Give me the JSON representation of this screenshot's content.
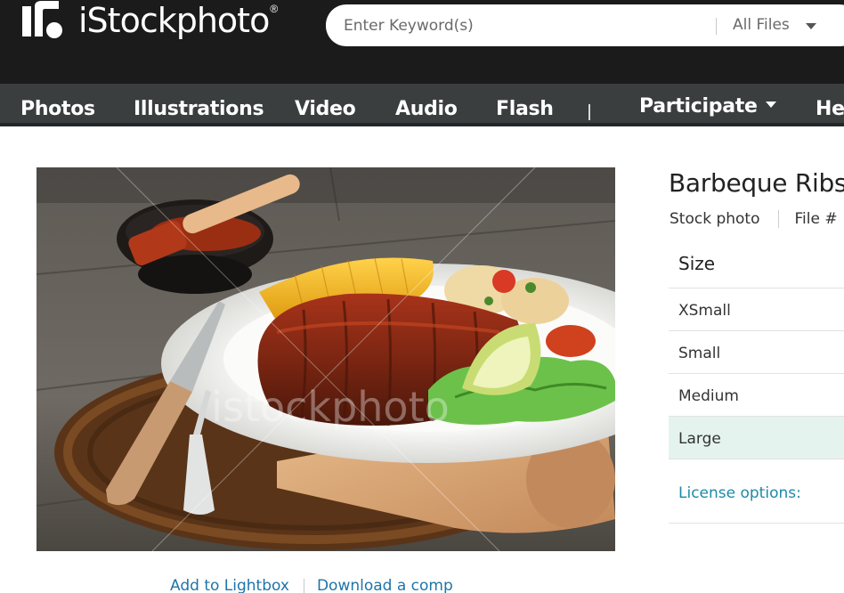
{
  "brand": {
    "name": "iStockphoto",
    "registered_mark": "®",
    "logo_icon": "istock-logo-icon"
  },
  "search": {
    "placeholder": "Enter Keyword(s)",
    "filter_value": "All Files"
  },
  "nav": {
    "items": [
      {
        "label": "Photos"
      },
      {
        "label": "Illustrations"
      },
      {
        "label": "Video"
      },
      {
        "label": "Audio"
      },
      {
        "label": "Flash"
      },
      {
        "label": "Participate"
      },
      {
        "label": "He"
      }
    ]
  },
  "photo": {
    "alt": "Barbeque Ribs",
    "watermark": "istockphoto"
  },
  "photo_actions": {
    "add_to_lightbox": "Add to Lightbox",
    "download_comp": "Download a comp"
  },
  "details": {
    "title": "Barbeque Ribs",
    "type": "Stock photo",
    "file_label": "File #"
  },
  "sizes": {
    "header": "Size",
    "rows": [
      {
        "label": "XSmall",
        "selected": false
      },
      {
        "label": "Small",
        "selected": false
      },
      {
        "label": "Medium",
        "selected": false
      },
      {
        "label": "Large",
        "selected": true
      }
    ],
    "license_link": "License options:"
  },
  "colors": {
    "header_bg": "#1b1b1b",
    "nav_bg": "#3a3e3f",
    "link": "#1e74a8",
    "selected_row": "#e5f3ee"
  }
}
